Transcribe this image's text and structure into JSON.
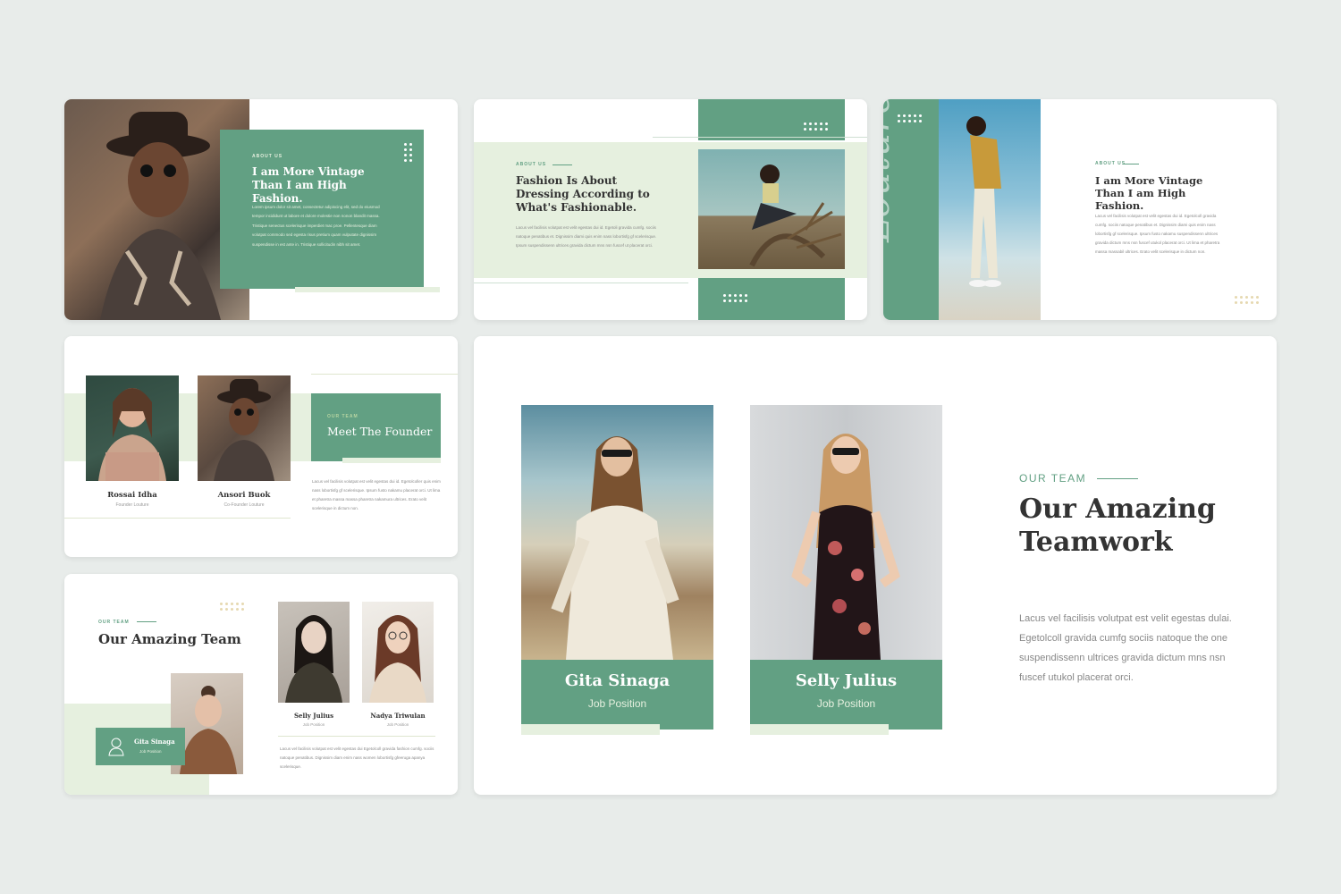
{
  "colors": {
    "accent": "#62a083",
    "light_accent": "#e6f0df",
    "background": "#e8ecea",
    "text_dark": "#333333"
  },
  "slide1": {
    "kicker": "ABOUT US",
    "title": "I am More Vintage Than I am High Fashion.",
    "body": "Lorem ipsum dolor sit amet, consectetur adipiscing elit, sed do eiusmod tempor incididunt ut labore et dolore molestie non nonon blandit massa. Tristique senectus scelerisque imperdiet mac proe. Pellentesque diam volutpat commodo sed egesta risus pretium quam vulputate dignissim suspendisse in est ante in. Tristique sollicitudin nibh sit amet."
  },
  "slide2": {
    "kicker": "ABOUT US",
    "title": "Fashion Is About Dressing According to What's Fashionable.",
    "body": "Lacus vel facilisis volutpat est velit egestas dui id. Egetoli gravida cumfg. sociis natoque penatibus et. Dignissim diami quis enim nass lobortisfg gf scelerisque. Ipsum suspendissenn ultrices gravida dictum mns nsn fuscef ut placerat orci."
  },
  "slide3": {
    "brand": "Louture",
    "kicker": "ABOUT US",
    "title": "I am More Vintage Than I am High Fashion.",
    "body": "Lacus vel facilisis volutpat est velit egestas dui id. Egetolcoll gravida cumfg. sociis natoque penatibus et. Dignissim diami quis enim nass lobortisfg gf scelerisque. Ipsum fusto nakamu suspendissenn ultrices gravida dictum mns nsn fuscef utukol placerat orci. Ut lima et pharetra massa massabil ultrices. Erato velit scelerisque in dictum non."
  },
  "slide4": {
    "kicker": "OUR TEAM",
    "title": "Meet The Founder",
    "members": [
      {
        "name": "Rossai Idha",
        "role": "Founder Louture"
      },
      {
        "name": "Ansori Buok",
        "role": "Co-Founder Louture"
      }
    ],
    "body": "Lacus vel facilisis volutpat est velit egestas dui id. Egetolcoller quis enim nass lobortisfg gf scelerisque. Ipsum fusto nakamu placerat orci. Ut lima et pharetra massa massa pharetra nakamura ultrices. Erato velit scelerisque in dictum non."
  },
  "slide5": {
    "kicker": "OUR TEAM",
    "title": "Our Amazing Team",
    "featured": {
      "name": "Gita Sinaga",
      "role": "Job Position"
    },
    "members": [
      {
        "name": "Selly Julius",
        "role": "Job Position"
      },
      {
        "name": "Nadya Triwulan",
        "role": "Job Position"
      }
    ],
    "body": "Lacus vel facilisis volutpat est velit egestas dui Egetolcoll gravida fashion cumfg. sociis natoque penatibus. Dignissim diam enim nass women lobortisfg gfeeruga apanya scelerisque."
  },
  "slide6": {
    "kicker": "OUR TEAM",
    "title_line1": "Our Amazing",
    "title_line2": "Teamwork",
    "members": [
      {
        "name": "Gita Sinaga",
        "role": "Job Position"
      },
      {
        "name": "Selly Julius",
        "role": "Job Position"
      }
    ],
    "body_lines": [
      "Lacus vel facilisis volutpat est velit egestas dulai.",
      "Egetolcoll gravida cumfg  sociis natoque the one",
      "suspendissenn ultrices gravida dictum mns nsn",
      "fuscef utukol placerat orci."
    ]
  }
}
